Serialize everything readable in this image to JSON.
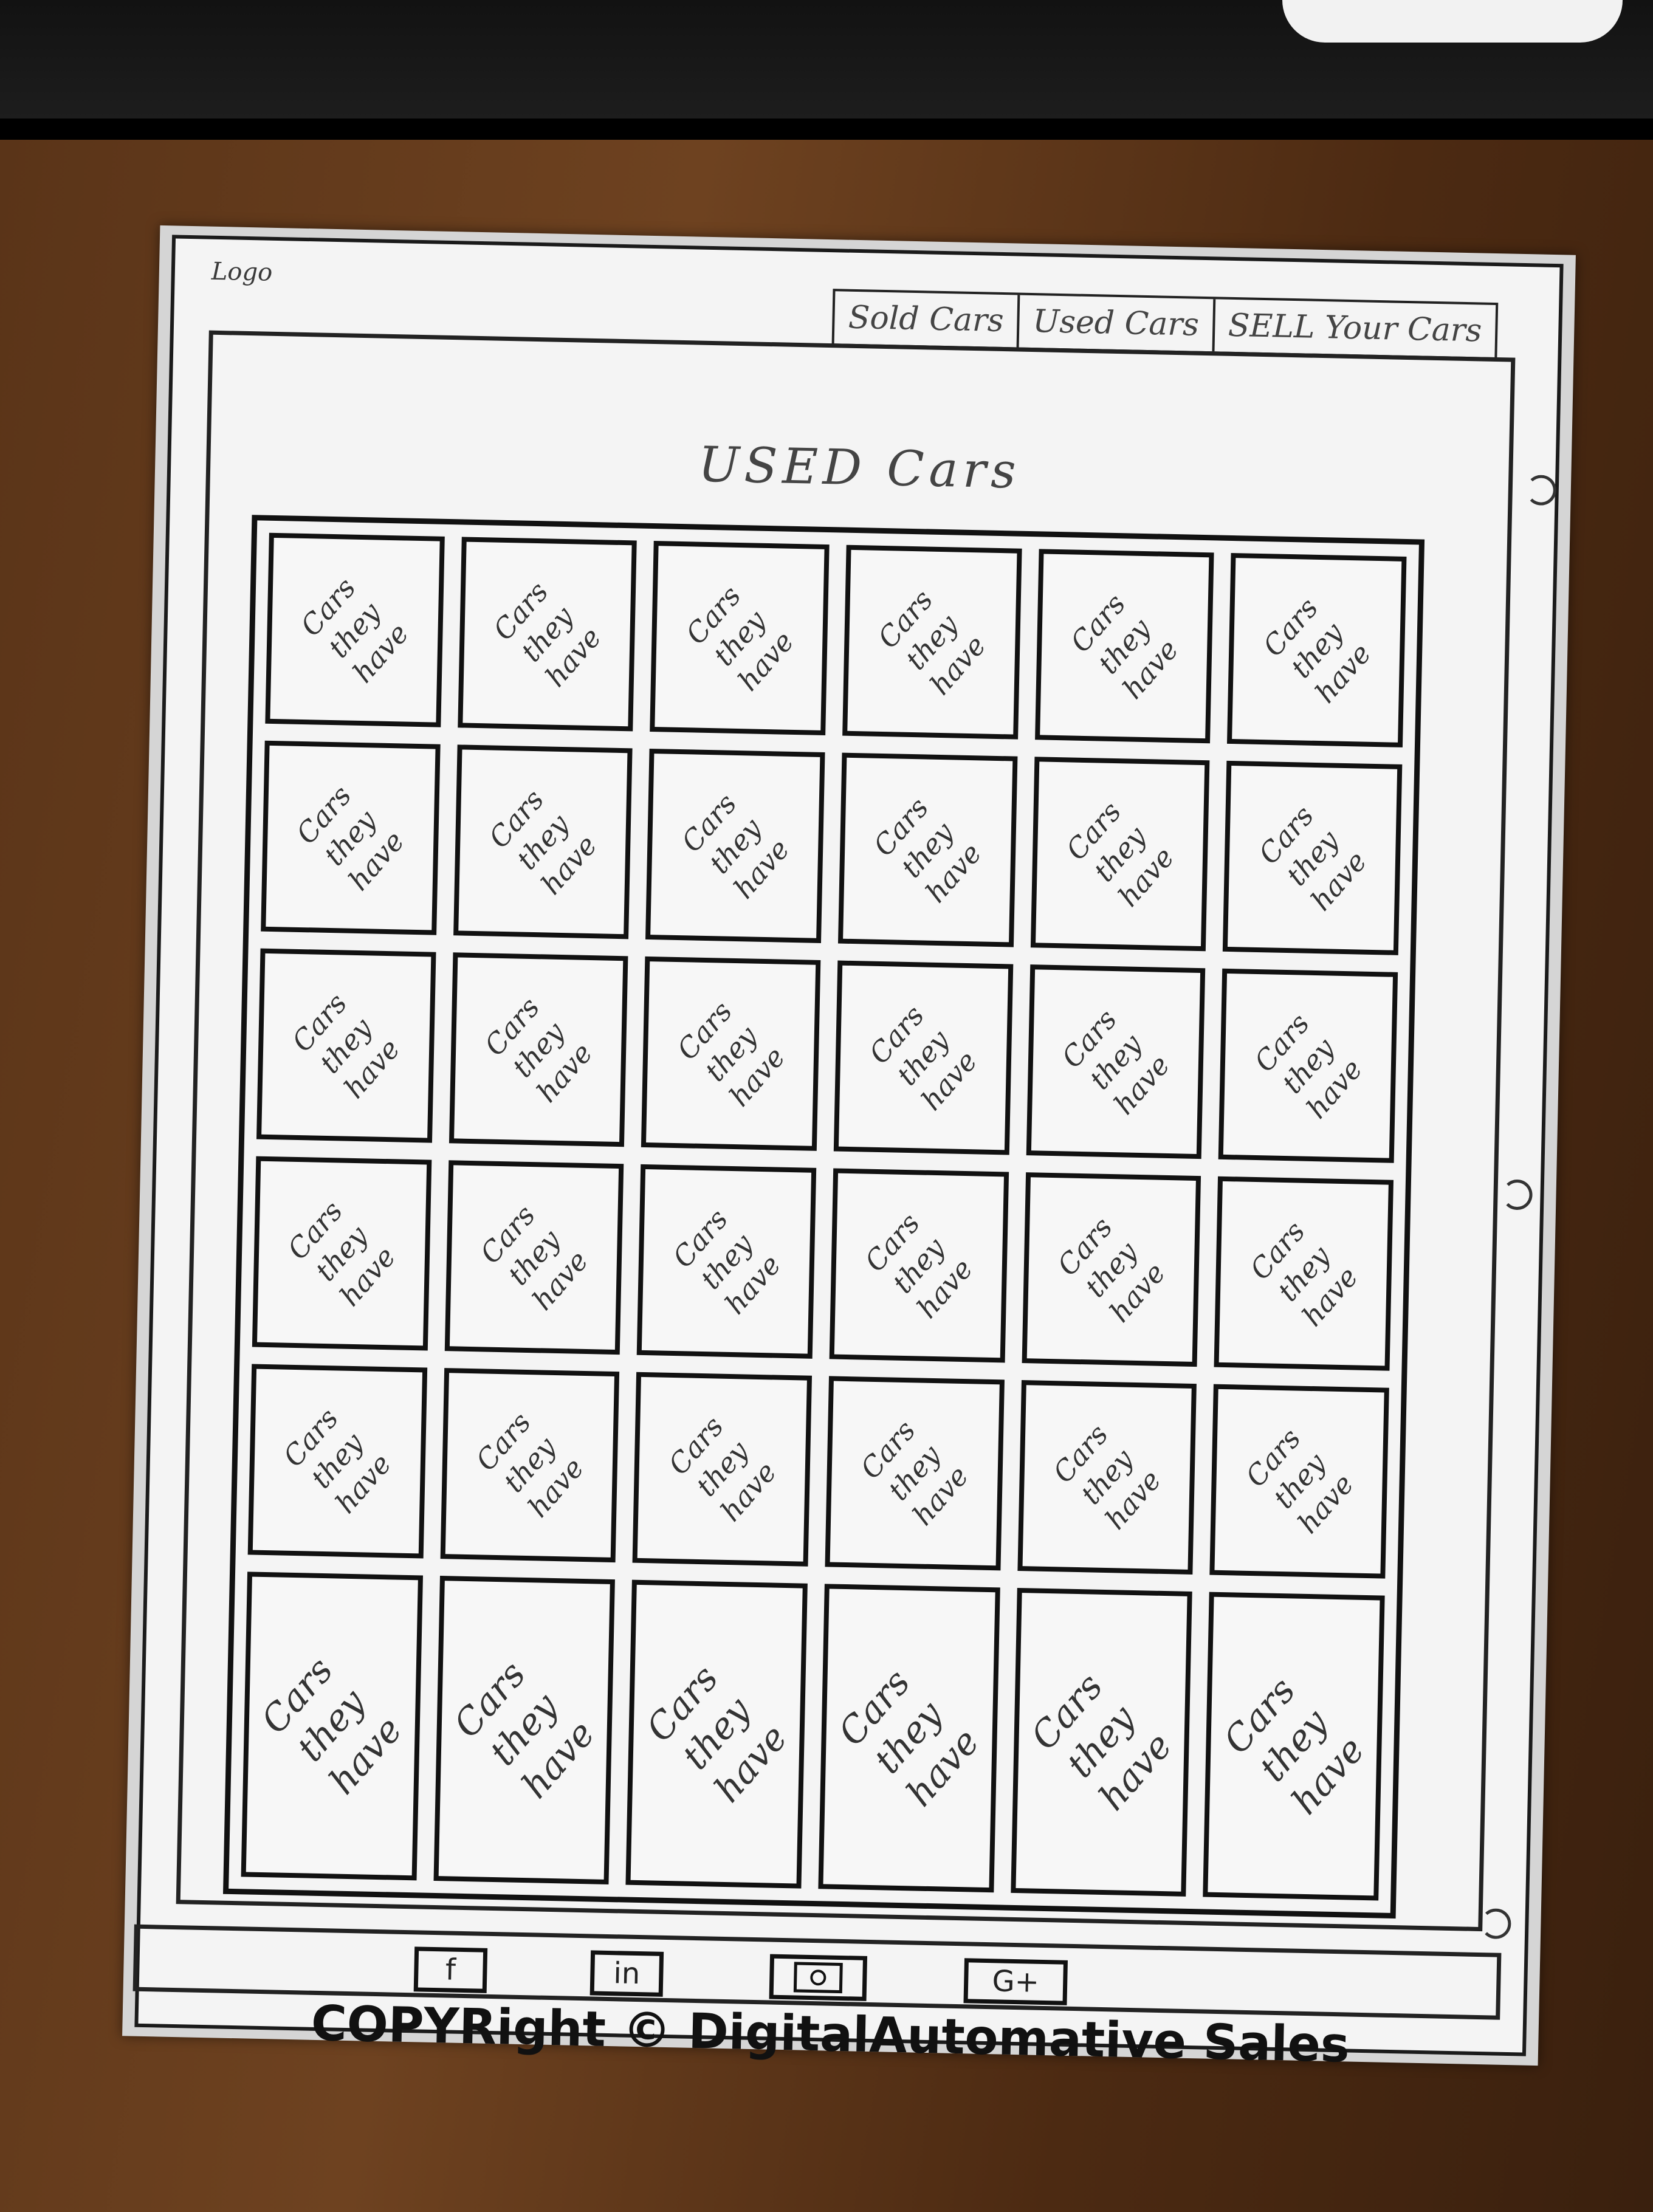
{
  "header": {
    "logo": "Logo",
    "nav": [
      "Sold Cars",
      "Used Cars",
      "SELL Your Cars"
    ]
  },
  "main": {
    "title": "USED Cars",
    "card_label": "Cars they have",
    "grid": {
      "columns": 6,
      "rows": 6
    }
  },
  "footer": {
    "social": [
      {
        "label": "f",
        "icon": "facebook-icon"
      },
      {
        "label": "in",
        "icon": "linkedin-icon"
      },
      {
        "label": "",
        "icon": "camera-icon"
      },
      {
        "label": "G+",
        "icon": "google-plus-icon"
      }
    ],
    "copyright": "COPYRight © DigitalAutomative Sales"
  }
}
